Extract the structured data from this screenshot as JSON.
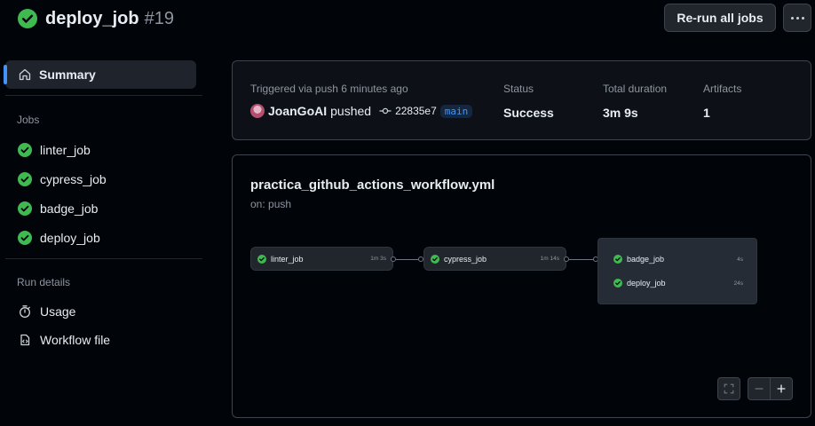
{
  "header": {
    "title": "deploy_job",
    "run_number": "#19"
  },
  "actions": {
    "rerun_label": "Re-run all jobs"
  },
  "sidebar": {
    "summary_label": "Summary",
    "jobs_heading": "Jobs",
    "jobs": [
      {
        "label": "linter_job"
      },
      {
        "label": "cypress_job"
      },
      {
        "label": "badge_job"
      },
      {
        "label": "deploy_job"
      }
    ],
    "run_details_heading": "Run details",
    "details": [
      {
        "label": "Usage",
        "icon": "stopwatch-icon"
      },
      {
        "label": "Workflow file",
        "icon": "file-code-icon"
      }
    ]
  },
  "summary": {
    "trigger_label": "Triggered via push 6 minutes ago",
    "actor": "JoanGoAI",
    "action": "pushed",
    "commit_sha": "22835e7",
    "branch": "main",
    "status_label": "Status",
    "status_value": "Success",
    "duration_label": "Total duration",
    "duration_value": "3m 9s",
    "artifacts_label": "Artifacts",
    "artifacts_value": "1"
  },
  "graph": {
    "workflow_file": "practica_github_actions_workflow.yml",
    "trigger": "on: push",
    "nodes": [
      {
        "label": "linter_job",
        "duration": "1m 3s"
      },
      {
        "label": "cypress_job",
        "duration": "1m 14s"
      }
    ],
    "group": [
      {
        "label": "badge_job",
        "duration": "4s"
      },
      {
        "label": "deploy_job",
        "duration": "24s"
      }
    ]
  },
  "colors": {
    "success": "#3fb950",
    "accent": "#4493f8",
    "background": "#010409"
  }
}
